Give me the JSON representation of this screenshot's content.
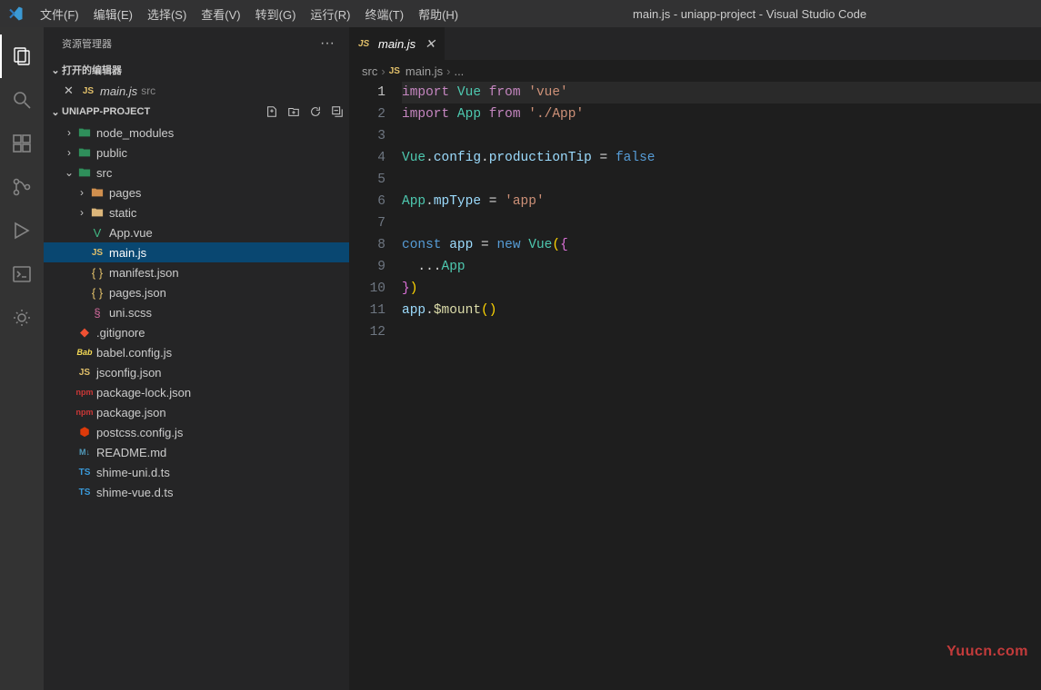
{
  "window_title": "main.js - uniapp-project - Visual Studio Code",
  "menubar": [
    "文件(F)",
    "编辑(E)",
    "选择(S)",
    "查看(V)",
    "转到(G)",
    "运行(R)",
    "终端(T)",
    "帮助(H)"
  ],
  "sidebar_title": "资源管理器",
  "open_editors_label": "打开的编辑器",
  "open_editor": {
    "name": "main.js",
    "dir": "src"
  },
  "project_name": "UNIAPP-PROJECT",
  "tree": [
    {
      "type": "folder",
      "name": "node_modules",
      "depth": 0,
      "open": false,
      "iconClass": "fi-folder-green"
    },
    {
      "type": "folder",
      "name": "public",
      "depth": 0,
      "open": false,
      "iconClass": "fi-folder-green"
    },
    {
      "type": "folder",
      "name": "src",
      "depth": 0,
      "open": true,
      "iconClass": "fi-folder-green"
    },
    {
      "type": "folder",
      "name": "pages",
      "depth": 1,
      "open": false,
      "iconClass": "fi-img"
    },
    {
      "type": "folder",
      "name": "static",
      "depth": 1,
      "open": false,
      "iconClass": "fi-folder"
    },
    {
      "type": "file",
      "name": "App.vue",
      "depth": 1,
      "iconClass": "fi-vue",
      "iconText": "V"
    },
    {
      "type": "file",
      "name": "main.js",
      "depth": 1,
      "iconClass": "fi-js",
      "iconText": "JS",
      "selected": true
    },
    {
      "type": "file",
      "name": "manifest.json",
      "depth": 1,
      "iconClass": "fi-json",
      "iconText": "{ }"
    },
    {
      "type": "file",
      "name": "pages.json",
      "depth": 1,
      "iconClass": "fi-json",
      "iconText": "{ }"
    },
    {
      "type": "file",
      "name": "uni.scss",
      "depth": 1,
      "iconClass": "fi-scss",
      "iconText": "§"
    },
    {
      "type": "file",
      "name": ".gitignore",
      "depth": 0,
      "iconClass": "fi-git",
      "iconText": "◆"
    },
    {
      "type": "file",
      "name": "babel.config.js",
      "depth": 0,
      "iconClass": "fi-babel",
      "iconText": "Bab"
    },
    {
      "type": "file",
      "name": "jsconfig.json",
      "depth": 0,
      "iconClass": "fi-js",
      "iconText": "JS"
    },
    {
      "type": "file",
      "name": "package-lock.json",
      "depth": 0,
      "iconClass": "fi-npm",
      "iconText": "npm"
    },
    {
      "type": "file",
      "name": "package.json",
      "depth": 0,
      "iconClass": "fi-npm",
      "iconText": "npm"
    },
    {
      "type": "file",
      "name": "postcss.config.js",
      "depth": 0,
      "iconClass": "fi-postcss",
      "iconText": "⬢"
    },
    {
      "type": "file",
      "name": "README.md",
      "depth": 0,
      "iconClass": "fi-md",
      "iconText": "M↓"
    },
    {
      "type": "file",
      "name": "shime-uni.d.ts",
      "depth": 0,
      "iconClass": "fi-ts",
      "iconText": "TS"
    },
    {
      "type": "file",
      "name": "shime-vue.d.ts",
      "depth": 0,
      "iconClass": "fi-ts",
      "iconText": "TS"
    }
  ],
  "tab": {
    "name": "main.js"
  },
  "breadcrumbs": [
    "src",
    "main.js",
    "..."
  ],
  "code_lines": [
    [
      {
        "t": "import ",
        "c": "tok-kw"
      },
      {
        "t": "Vue ",
        "c": "tok-cls"
      },
      {
        "t": "from ",
        "c": "tok-kw"
      },
      {
        "t": "'vue'",
        "c": "tok-str"
      }
    ],
    [
      {
        "t": "import ",
        "c": "tok-kw"
      },
      {
        "t": "App ",
        "c": "tok-cls"
      },
      {
        "t": "from ",
        "c": "tok-kw"
      },
      {
        "t": "'./App'",
        "c": "tok-str"
      }
    ],
    [],
    [
      {
        "t": "Vue",
        "c": "tok-cls"
      },
      {
        "t": ".",
        "c": ""
      },
      {
        "t": "config",
        "c": "tok-prop"
      },
      {
        "t": ".",
        "c": ""
      },
      {
        "t": "productionTip",
        "c": "tok-prop"
      },
      {
        "t": " = ",
        "c": ""
      },
      {
        "t": "false",
        "c": "tok-const"
      }
    ],
    [],
    [
      {
        "t": "App",
        "c": "tok-cls"
      },
      {
        "t": ".",
        "c": ""
      },
      {
        "t": "mpType",
        "c": "tok-prop"
      },
      {
        "t": " = ",
        "c": ""
      },
      {
        "t": "'app'",
        "c": "tok-str"
      }
    ],
    [],
    [
      {
        "t": "const ",
        "c": "tok-new"
      },
      {
        "t": "app",
        "c": "tok-prop"
      },
      {
        "t": " = ",
        "c": ""
      },
      {
        "t": "new ",
        "c": "tok-new"
      },
      {
        "t": "Vue",
        "c": "tok-cls"
      },
      {
        "t": "(",
        "c": "tok-yellow"
      },
      {
        "t": "{",
        "c": "tok-purple"
      }
    ],
    [
      {
        "t": "  ...",
        "c": ""
      },
      {
        "t": "App",
        "c": "tok-cls"
      }
    ],
    [
      {
        "t": "}",
        "c": "tok-purple"
      },
      {
        "t": ")",
        "c": "tok-yellow"
      }
    ],
    [
      {
        "t": "app",
        "c": "tok-prop"
      },
      {
        "t": ".",
        "c": ""
      },
      {
        "t": "$mount",
        "c": "tok-func"
      },
      {
        "t": "(",
        "c": "tok-yellow"
      },
      {
        "t": ")",
        "c": "tok-yellow"
      }
    ],
    []
  ],
  "current_line": 1,
  "watermark": "Yuucn.com"
}
